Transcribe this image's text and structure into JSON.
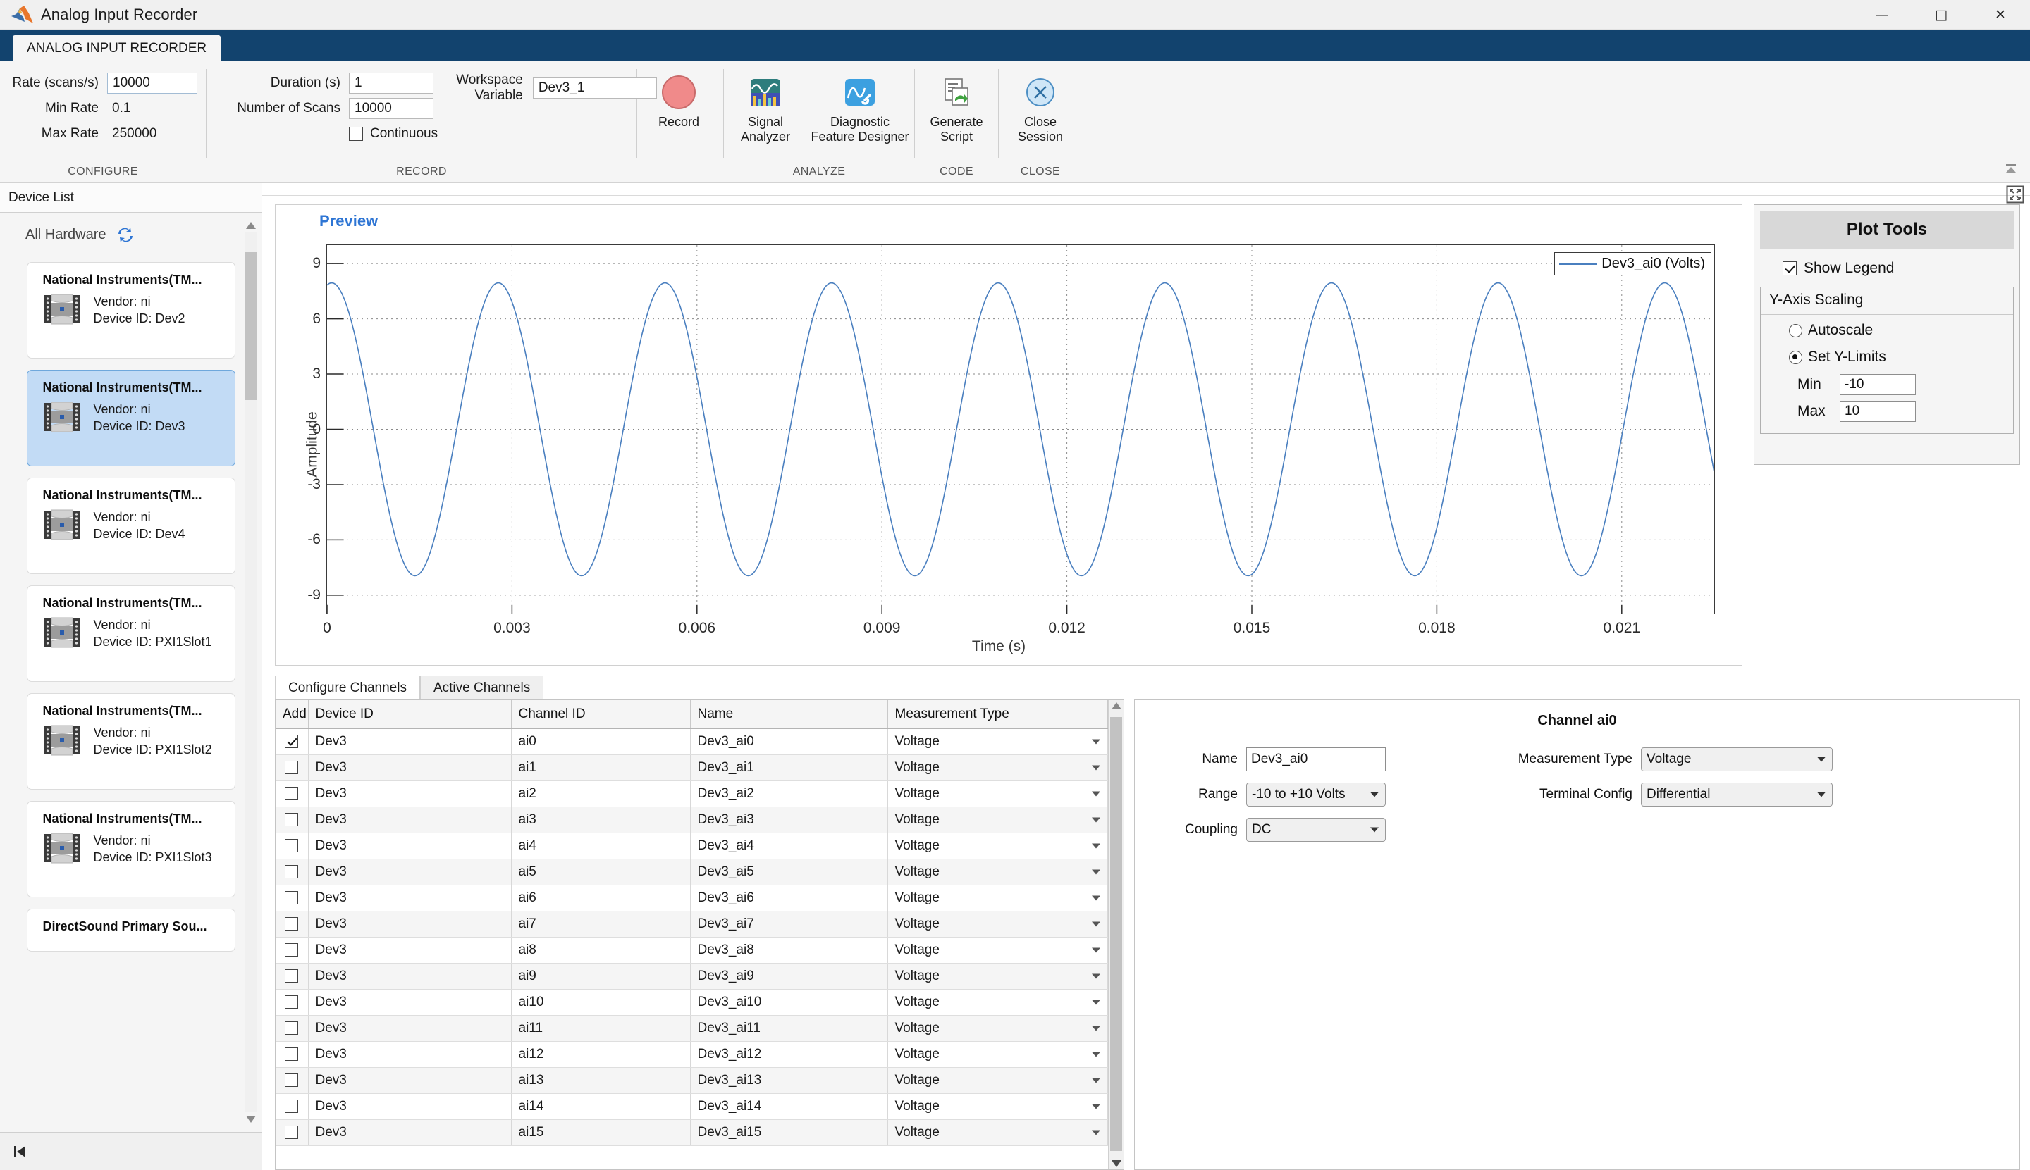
{
  "window": {
    "title": "Analog Input Recorder",
    "minimize": "—",
    "maximize": "□",
    "close": "✕"
  },
  "ribbon": {
    "tab_label": "ANALOG INPUT RECORDER",
    "configure": {
      "group_label": "CONFIGURE",
      "rate_label": "Rate (scans/s)",
      "rate_value": "10000",
      "min_rate_label": "Min Rate",
      "min_rate_value": "0.1",
      "max_rate_label": "Max Rate",
      "max_rate_value": "250000"
    },
    "record": {
      "group_label": "RECORD",
      "duration_label": "Duration (s)",
      "duration_value": "1",
      "scans_label": "Number of Scans",
      "scans_value": "10000",
      "continuous_label": "Continuous",
      "continuous_checked": false,
      "workspace_label": "Workspace Variable",
      "workspace_value": "Dev3_1",
      "record_button": "Record"
    },
    "analyze": {
      "group_label": "ANALYZE",
      "signal_analyzer": "Signal\nAnalyzer",
      "signal_analyzer_l1": "Signal",
      "signal_analyzer_l2": "Analyzer",
      "diagnostic_l1": "Diagnostic",
      "diagnostic_l2": "Feature Designer"
    },
    "code": {
      "group_label": "CODE",
      "generate_l1": "Generate",
      "generate_l2": "Script"
    },
    "close": {
      "group_label": "CLOSE",
      "close_l1": "Close",
      "close_l2": "Session"
    }
  },
  "sidebar": {
    "title": "Device List",
    "all_hardware": "All Hardware",
    "devices": [
      {
        "name": "National Instruments(TM...",
        "vendor": "Vendor: ni",
        "device_id": "Device ID: Dev2",
        "selected": false
      },
      {
        "name": "National Instruments(TM...",
        "vendor": "Vendor: ni",
        "device_id": "Device ID: Dev3",
        "selected": true
      },
      {
        "name": "National Instruments(TM...",
        "vendor": "Vendor: ni",
        "device_id": "Device ID: Dev4",
        "selected": false
      },
      {
        "name": "National Instruments(TM...",
        "vendor": "Vendor: ni",
        "device_id": "Device ID: PXI1Slot1",
        "selected": false
      },
      {
        "name": "National Instruments(TM...",
        "vendor": "Vendor: ni",
        "device_id": "Device ID: PXI1Slot2",
        "selected": false
      },
      {
        "name": "National Instruments(TM...",
        "vendor": "Vendor: ni",
        "device_id": "Device ID: PXI1Slot3",
        "selected": false
      },
      {
        "name": "DirectSound Primary Sou...",
        "vendor": "",
        "device_id": "",
        "selected": false
      }
    ]
  },
  "preview": {
    "title": "Preview"
  },
  "chart_data": {
    "type": "line",
    "title": "Preview",
    "xlabel": "Time (s)",
    "ylabel": "Amplitude",
    "xlim": [
      0,
      0.0225
    ],
    "ylim": [
      -10,
      10
    ],
    "xticks": [
      0,
      0.003,
      0.006,
      0.009,
      0.012,
      0.015,
      0.018,
      0.021
    ],
    "xticklabels": [
      "0",
      "0.003",
      "0.006",
      "0.009",
      "0.012",
      "0.015",
      "0.018",
      "0.021"
    ],
    "yticks": [
      -9,
      -6,
      -3,
      0,
      3,
      6,
      9
    ],
    "yticklabels": [
      "-9",
      "-6",
      "-3",
      "0",
      "3",
      "6",
      "9"
    ],
    "grid": true,
    "legend_position": "top-right",
    "series": [
      {
        "name": "Dev3_ai0 (Volts)",
        "color": "#4a7fbf",
        "waveform": "sine",
        "amplitude": 7.95,
        "frequency_hz": 370,
        "phase_deg": 80,
        "offset": 0
      }
    ]
  },
  "plot_tools": {
    "header": "Plot Tools",
    "show_legend_label": "Show Legend",
    "show_legend_checked": true,
    "yaxis_scaling_label": "Y-Axis Scaling",
    "autoscale_label": "Autoscale",
    "set_ylimits_label": "Set Y-Limits",
    "selected_mode": "set_ylimits",
    "min_label": "Min",
    "min_value": "-10",
    "max_label": "Max",
    "max_value": "10"
  },
  "tabs": [
    {
      "label": "Configure Channels",
      "active": true
    },
    {
      "label": "Active Channels",
      "active": false
    }
  ],
  "channel_table": {
    "columns": [
      "Add",
      "Device ID",
      "Channel ID",
      "Name",
      "Measurement Type"
    ],
    "rows": [
      {
        "add": true,
        "device_id": "Dev3",
        "channel_id": "ai0",
        "name": "Dev3_ai0",
        "measurement_type": "Voltage"
      },
      {
        "add": false,
        "device_id": "Dev3",
        "channel_id": "ai1",
        "name": "Dev3_ai1",
        "measurement_type": "Voltage"
      },
      {
        "add": false,
        "device_id": "Dev3",
        "channel_id": "ai2",
        "name": "Dev3_ai2",
        "measurement_type": "Voltage"
      },
      {
        "add": false,
        "device_id": "Dev3",
        "channel_id": "ai3",
        "name": "Dev3_ai3",
        "measurement_type": "Voltage"
      },
      {
        "add": false,
        "device_id": "Dev3",
        "channel_id": "ai4",
        "name": "Dev3_ai4",
        "measurement_type": "Voltage"
      },
      {
        "add": false,
        "device_id": "Dev3",
        "channel_id": "ai5",
        "name": "Dev3_ai5",
        "measurement_type": "Voltage"
      },
      {
        "add": false,
        "device_id": "Dev3",
        "channel_id": "ai6",
        "name": "Dev3_ai6",
        "measurement_type": "Voltage"
      },
      {
        "add": false,
        "device_id": "Dev3",
        "channel_id": "ai7",
        "name": "Dev3_ai7",
        "measurement_type": "Voltage"
      },
      {
        "add": false,
        "device_id": "Dev3",
        "channel_id": "ai8",
        "name": "Dev3_ai8",
        "measurement_type": "Voltage"
      },
      {
        "add": false,
        "device_id": "Dev3",
        "channel_id": "ai9",
        "name": "Dev3_ai9",
        "measurement_type": "Voltage"
      },
      {
        "add": false,
        "device_id": "Dev3",
        "channel_id": "ai10",
        "name": "Dev3_ai10",
        "measurement_type": "Voltage"
      },
      {
        "add": false,
        "device_id": "Dev3",
        "channel_id": "ai11",
        "name": "Dev3_ai11",
        "measurement_type": "Voltage"
      },
      {
        "add": false,
        "device_id": "Dev3",
        "channel_id": "ai12",
        "name": "Dev3_ai12",
        "measurement_type": "Voltage"
      },
      {
        "add": false,
        "device_id": "Dev3",
        "channel_id": "ai13",
        "name": "Dev3_ai13",
        "measurement_type": "Voltage"
      },
      {
        "add": false,
        "device_id": "Dev3",
        "channel_id": "ai14",
        "name": "Dev3_ai14",
        "measurement_type": "Voltage"
      },
      {
        "add": false,
        "device_id": "Dev3",
        "channel_id": "ai15",
        "name": "Dev3_ai15",
        "measurement_type": "Voltage"
      }
    ]
  },
  "channel_props": {
    "title": "Channel ai0",
    "name_label": "Name",
    "name_value": "Dev3_ai0",
    "range_label": "Range",
    "range_value": "-10 to +10 Volts",
    "coupling_label": "Coupling",
    "coupling_value": "DC",
    "measurement_type_label": "Measurement Type",
    "measurement_type_value": "Voltage",
    "terminal_config_label": "Terminal Config",
    "terminal_config_value": "Differential"
  },
  "colors": {
    "ribbon_blue": "#12436e",
    "accent_blue": "#2e75d4",
    "series_blue": "#4a7fbf",
    "selection_blue": "#c2dbf5"
  }
}
